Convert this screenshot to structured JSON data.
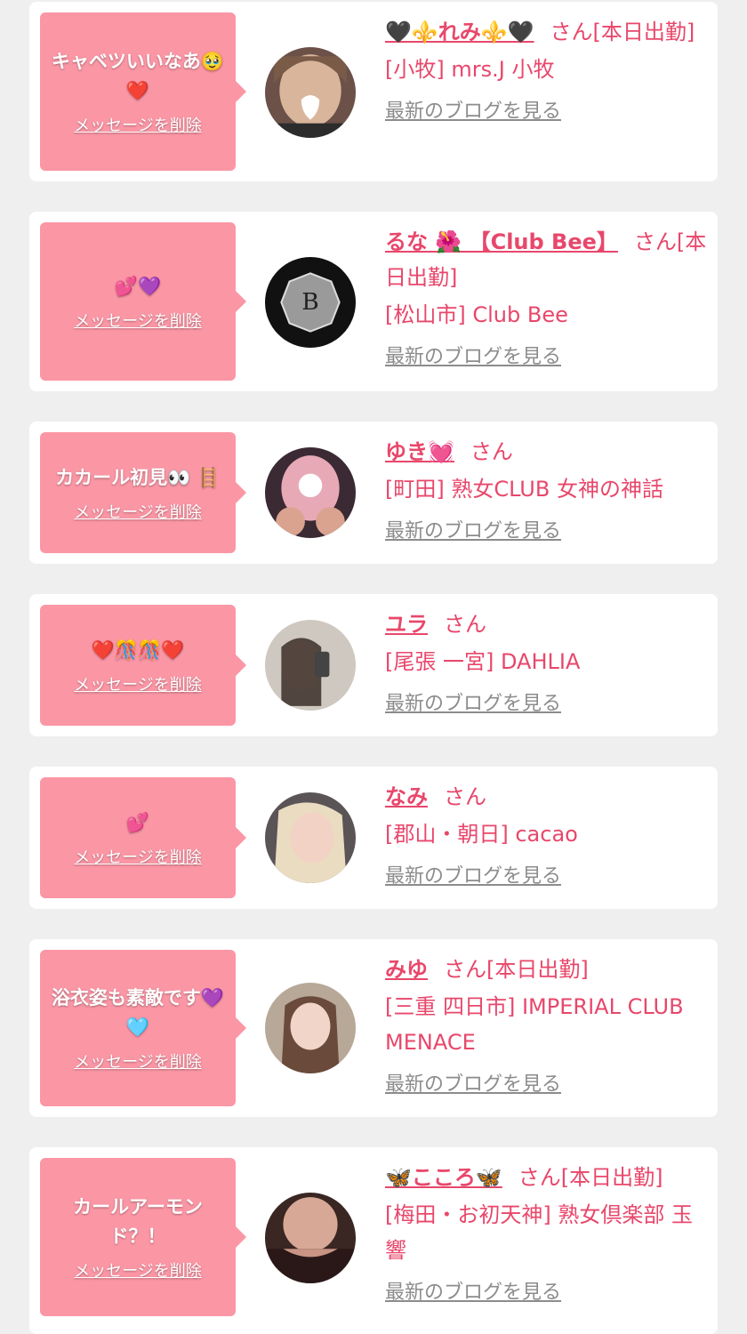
{
  "common": {
    "delete_label": "メッセージを削除",
    "blog_label": "最新のブログを見る"
  },
  "items": [
    {
      "message": "キャベツいいなあ🥹❤️",
      "name": "🖤⚜️れみ⚜️🖤",
      "suffix": "さん[本日出勤]",
      "shop": "[小牧] mrs.J 小牧"
    },
    {
      "message": "💕💜",
      "name": "るな 🌺 【Club Bee】",
      "suffix": "さん[本日出勤]",
      "shop": "[松山市] Club Bee"
    },
    {
      "message": "カカール初見👀 🪜",
      "name": "ゆき💓",
      "suffix": "さん",
      "shop": "[町田] 熟女CLUB 女神の神話"
    },
    {
      "message": "❤️🎊🎊❤️",
      "name": "ユラ",
      "suffix": "さん",
      "shop": "[尾張 一宮] DAHLIA"
    },
    {
      "message": "💕",
      "name": "なみ",
      "suffix": "さん",
      "shop": "[郡山・朝日] cacao"
    },
    {
      "message": "浴衣姿も素敵です💜🩵",
      "name": "みゆ",
      "suffix": "さん[本日出勤]",
      "shop": "[三重 四日市] IMPERIAL CLUB MENACE"
    },
    {
      "message": "カールアーモンド？！",
      "name": "🦋こころ🦋",
      "suffix": "さん[本日出勤]",
      "shop": "[梅田・お初天神] 熟女倶楽部 玉響"
    }
  ]
}
